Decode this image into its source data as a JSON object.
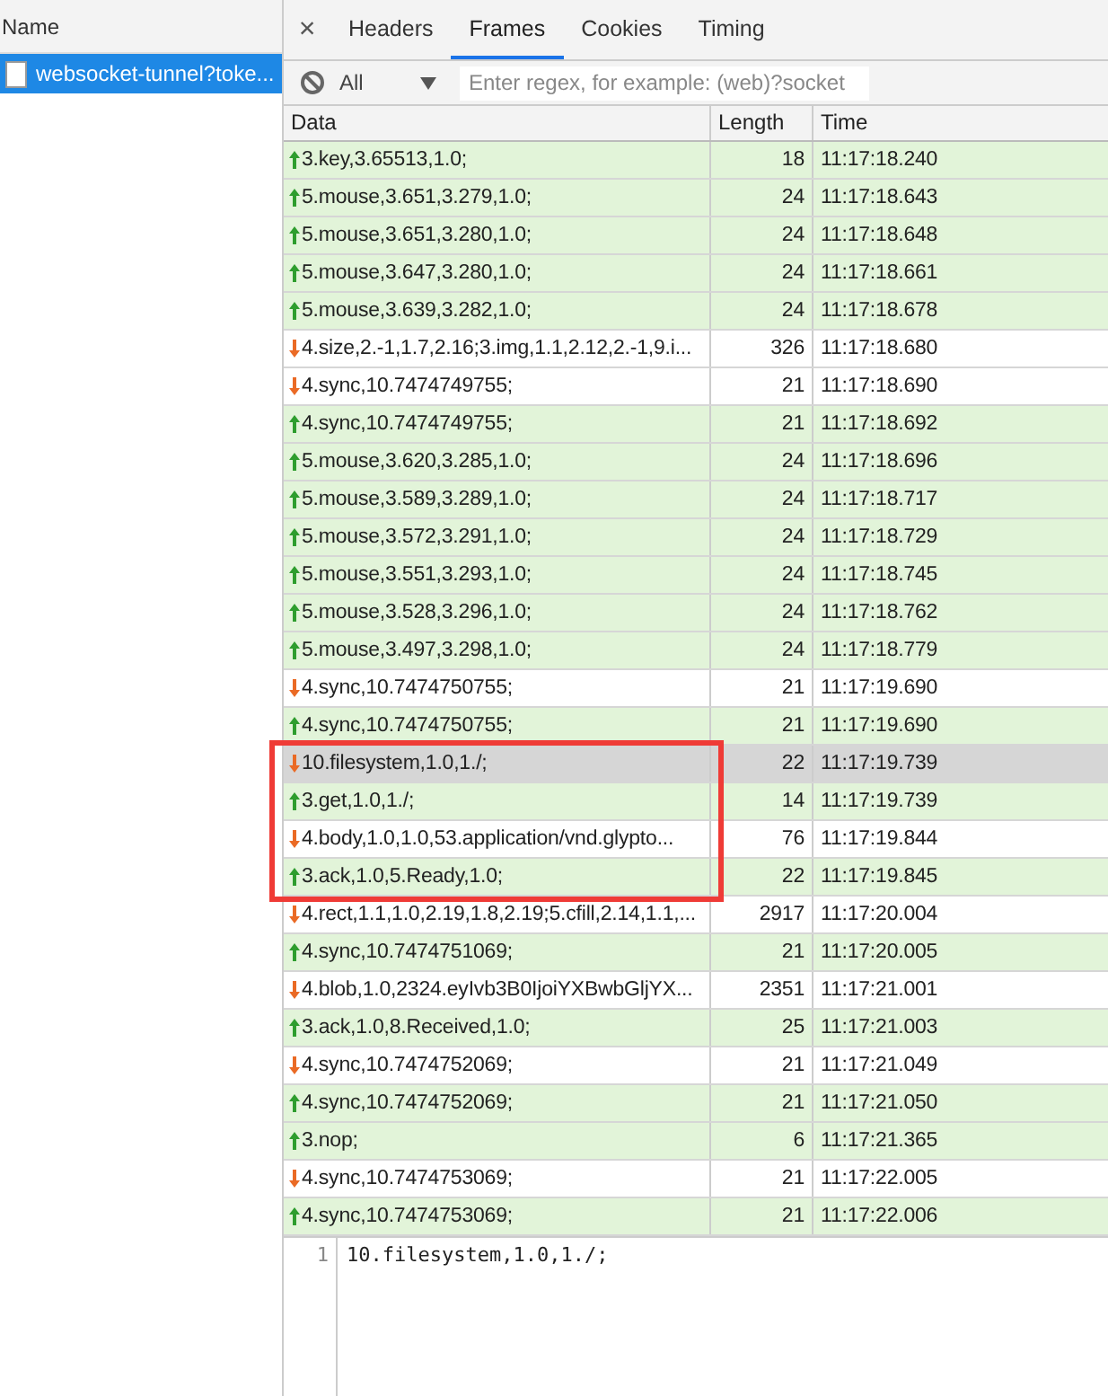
{
  "sidebar": {
    "header": "Name",
    "items": [
      {
        "label": "websocket-tunnel?toke...",
        "selected": true
      }
    ]
  },
  "tabs": {
    "close": "×",
    "items": [
      {
        "label": "Headers",
        "selected": false
      },
      {
        "label": "Frames",
        "selected": true
      },
      {
        "label": "Cookies",
        "selected": false
      },
      {
        "label": "Timing",
        "selected": false
      }
    ]
  },
  "filter": {
    "type": "All",
    "placeholder": "Enter regex, for example: (web)?socket"
  },
  "table": {
    "columns": [
      "Data",
      "Length",
      "Time"
    ],
    "rows": [
      {
        "data": "3.key,3.65513,1.0;",
        "length": "18",
        "time": "11:17:18.240",
        "kind": "sent",
        "selected": false,
        "boxed": false
      },
      {
        "data": "5.mouse,3.651,3.279,1.0;",
        "length": "24",
        "time": "11:17:18.643",
        "kind": "sent",
        "selected": false,
        "boxed": false
      },
      {
        "data": "5.mouse,3.651,3.280,1.0;",
        "length": "24",
        "time": "11:17:18.648",
        "kind": "sent",
        "selected": false,
        "boxed": false
      },
      {
        "data": "5.mouse,3.647,3.280,1.0;",
        "length": "24",
        "time": "11:17:18.661",
        "kind": "sent",
        "selected": false,
        "boxed": false
      },
      {
        "data": "5.mouse,3.639,3.282,1.0;",
        "length": "24",
        "time": "11:17:18.678",
        "kind": "sent",
        "selected": false,
        "boxed": false
      },
      {
        "data": "4.size,2.-1,1.7,2.16;3.img,1.1,2.12,2.-1,9.i...",
        "length": "326",
        "time": "11:17:18.680",
        "kind": "received",
        "selected": false,
        "boxed": false
      },
      {
        "data": "4.sync,10.7474749755;",
        "length": "21",
        "time": "11:17:18.690",
        "kind": "received",
        "selected": false,
        "boxed": false
      },
      {
        "data": "4.sync,10.7474749755;",
        "length": "21",
        "time": "11:17:18.692",
        "kind": "sent",
        "selected": false,
        "boxed": false
      },
      {
        "data": "5.mouse,3.620,3.285,1.0;",
        "length": "24",
        "time": "11:17:18.696",
        "kind": "sent",
        "selected": false,
        "boxed": false
      },
      {
        "data": "5.mouse,3.589,3.289,1.0;",
        "length": "24",
        "time": "11:17:18.717",
        "kind": "sent",
        "selected": false,
        "boxed": false
      },
      {
        "data": "5.mouse,3.572,3.291,1.0;",
        "length": "24",
        "time": "11:17:18.729",
        "kind": "sent",
        "selected": false,
        "boxed": false
      },
      {
        "data": "5.mouse,3.551,3.293,1.0;",
        "length": "24",
        "time": "11:17:18.745",
        "kind": "sent",
        "selected": false,
        "boxed": false
      },
      {
        "data": "5.mouse,3.528,3.296,1.0;",
        "length": "24",
        "time": "11:17:18.762",
        "kind": "sent",
        "selected": false,
        "boxed": false
      },
      {
        "data": "5.mouse,3.497,3.298,1.0;",
        "length": "24",
        "time": "11:17:18.779",
        "kind": "sent",
        "selected": false,
        "boxed": false
      },
      {
        "data": "4.sync,10.7474750755;",
        "length": "21",
        "time": "11:17:19.690",
        "kind": "received",
        "selected": false,
        "boxed": false
      },
      {
        "data": "4.sync,10.7474750755;",
        "length": "21",
        "time": "11:17:19.690",
        "kind": "sent",
        "selected": false,
        "boxed": false
      },
      {
        "data": "10.filesystem,1.0,1./;",
        "length": "22",
        "time": "11:17:19.739",
        "kind": "received",
        "selected": true,
        "boxed": true
      },
      {
        "data": "3.get,1.0,1./;",
        "length": "14",
        "time": "11:17:19.739",
        "kind": "sent",
        "selected": false,
        "boxed": true
      },
      {
        "data": "4.body,1.0,1.0,53.application/vnd.glypto...",
        "length": "76",
        "time": "11:17:19.844",
        "kind": "received",
        "selected": false,
        "boxed": true
      },
      {
        "data": "3.ack,1.0,5.Ready,1.0;",
        "length": "22",
        "time": "11:17:19.845",
        "kind": "sent",
        "selected": false,
        "boxed": true
      },
      {
        "data": "4.rect,1.1,1.0,2.19,1.8,2.19;5.cfill,2.14,1.1,...",
        "length": "2917",
        "time": "11:17:20.004",
        "kind": "received",
        "selected": false,
        "boxed": false
      },
      {
        "data": "4.sync,10.7474751069;",
        "length": "21",
        "time": "11:17:20.005",
        "kind": "sent",
        "selected": false,
        "boxed": false
      },
      {
        "data": "4.blob,1.0,2324.eyIvb3B0IjoiYXBwbGljYX...",
        "length": "2351",
        "time": "11:17:21.001",
        "kind": "received",
        "selected": false,
        "boxed": false
      },
      {
        "data": "3.ack,1.0,8.Received,1.0;",
        "length": "25",
        "time": "11:17:21.003",
        "kind": "sent",
        "selected": false,
        "boxed": false
      },
      {
        "data": "4.sync,10.7474752069;",
        "length": "21",
        "time": "11:17:21.049",
        "kind": "received",
        "selected": false,
        "boxed": false
      },
      {
        "data": "4.sync,10.7474752069;",
        "length": "21",
        "time": "11:17:21.050",
        "kind": "sent",
        "selected": false,
        "boxed": false
      },
      {
        "data": "3.nop;",
        "length": "6",
        "time": "11:17:21.365",
        "kind": "sent",
        "selected": false,
        "boxed": false
      },
      {
        "data": "4.sync,10.7474753069;",
        "length": "21",
        "time": "11:17:22.005",
        "kind": "received",
        "selected": false,
        "boxed": false
      },
      {
        "data": "4.sync,10.7474753069;",
        "length": "21",
        "time": "11:17:22.006",
        "kind": "sent",
        "selected": false,
        "boxed": false
      }
    ]
  },
  "viewer": {
    "lines": [
      {
        "number": "1",
        "text": "10.filesystem,1.0,1./;"
      }
    ]
  }
}
